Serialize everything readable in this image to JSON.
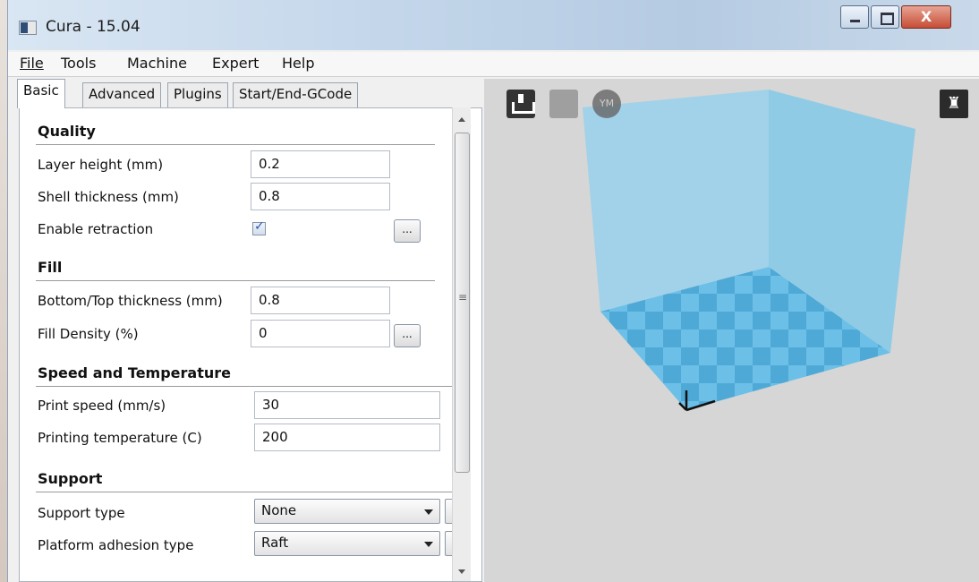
{
  "window": {
    "title": "Cura - 15.04"
  },
  "menu": [
    "File",
    "Tools",
    "Machine",
    "Expert",
    "Help"
  ],
  "tabs": [
    "Basic",
    "Advanced",
    "Plugins",
    "Start/End-GCode"
  ],
  "sections": {
    "quality": "Quality",
    "fill": "Fill",
    "speed": "Speed and Temperature",
    "support": "Support"
  },
  "fields": {
    "layer_height": {
      "label": "Layer height (mm)",
      "value": "0.2"
    },
    "shell_thickness": {
      "label": "Shell thickness (mm)",
      "value": "0.8"
    },
    "enable_retraction": {
      "label": "Enable retraction",
      "checked": true
    },
    "bottom_top_thickness": {
      "label": "Bottom/Top thickness (mm)",
      "value": "0.8"
    },
    "fill_density": {
      "label": "Fill Density (%)",
      "value": "0"
    },
    "print_speed": {
      "label": "Print speed (mm/s)",
      "value": "30"
    },
    "printing_temperature": {
      "label": "Printing temperature (C)",
      "value": "200"
    },
    "support_type": {
      "label": "Support type",
      "value": "None"
    },
    "platform_adhesion": {
      "label": "Platform adhesion type",
      "value": "Raft"
    }
  },
  "buttons": {
    "more": "..."
  },
  "view": {
    "toolbar": [
      "load-icon",
      "print-icon",
      "youmagine-icon",
      "view-mode-icon"
    ],
    "ym_label": "YM",
    "colors": {
      "background": "#d6d6d6",
      "volume": "#7ec8ea",
      "grid_light": "#6cc0e8",
      "grid_dark": "#4fa9d6"
    }
  }
}
